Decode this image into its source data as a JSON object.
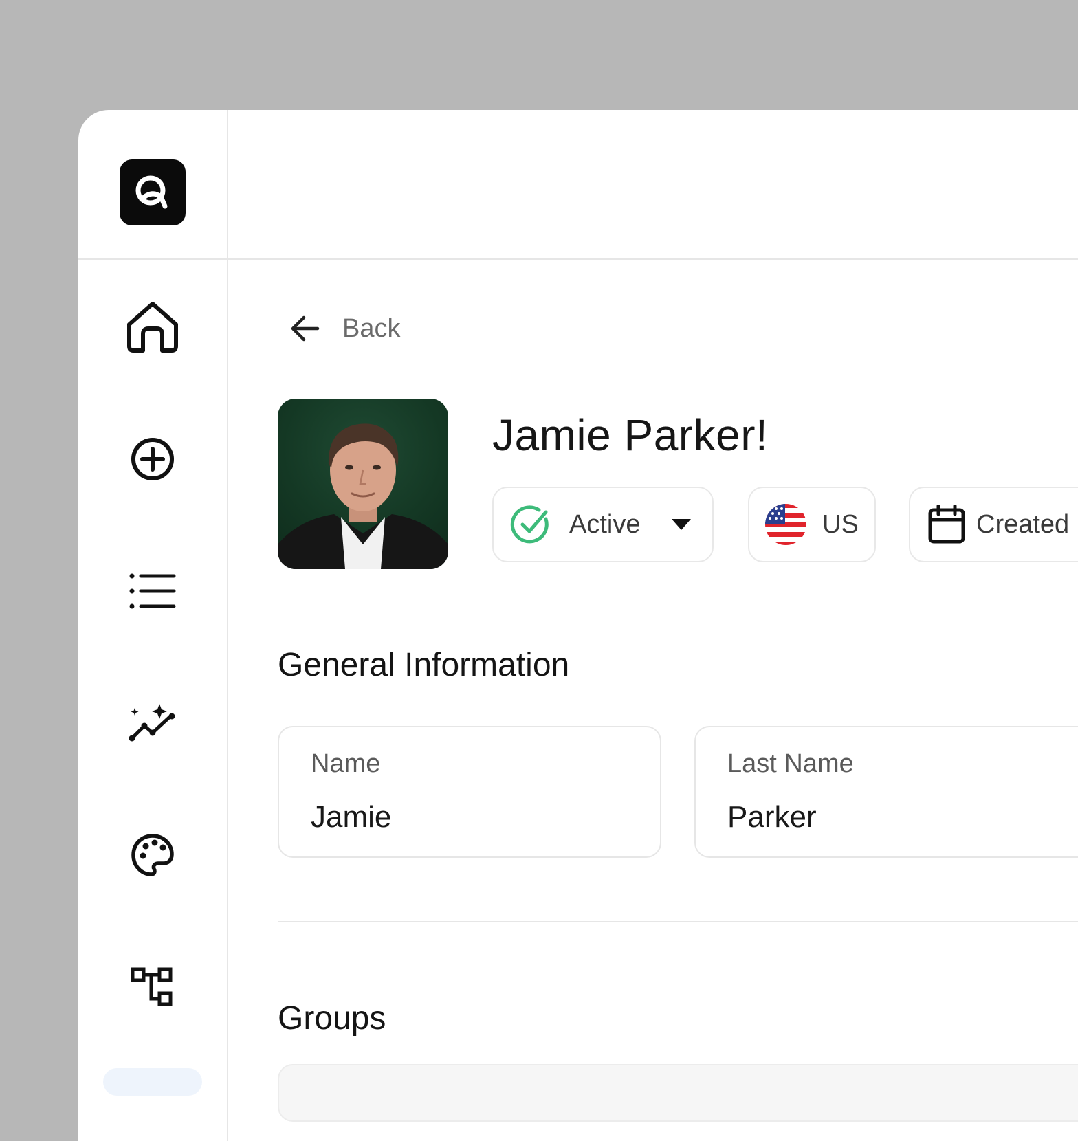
{
  "header": {
    "back_label": "Back"
  },
  "profile": {
    "title": "Jamie Parker!",
    "status": {
      "label": "Active",
      "color": "#3dbb7a"
    },
    "country": {
      "code": "US"
    },
    "created": {
      "label": "Created"
    }
  },
  "general_information": {
    "title": "General Information",
    "fields": [
      {
        "label": "Name",
        "value": "Jamie"
      },
      {
        "label": "Last Name",
        "value": "Parker"
      }
    ]
  },
  "groups": {
    "title": "Groups"
  },
  "sidebar": {
    "items": [
      {
        "icon": "home-icon"
      },
      {
        "icon": "plus-circle-icon"
      },
      {
        "icon": "list-icon"
      },
      {
        "icon": "analytics-sparkle-icon"
      },
      {
        "icon": "palette-icon"
      },
      {
        "icon": "hierarchy-icon"
      }
    ]
  }
}
